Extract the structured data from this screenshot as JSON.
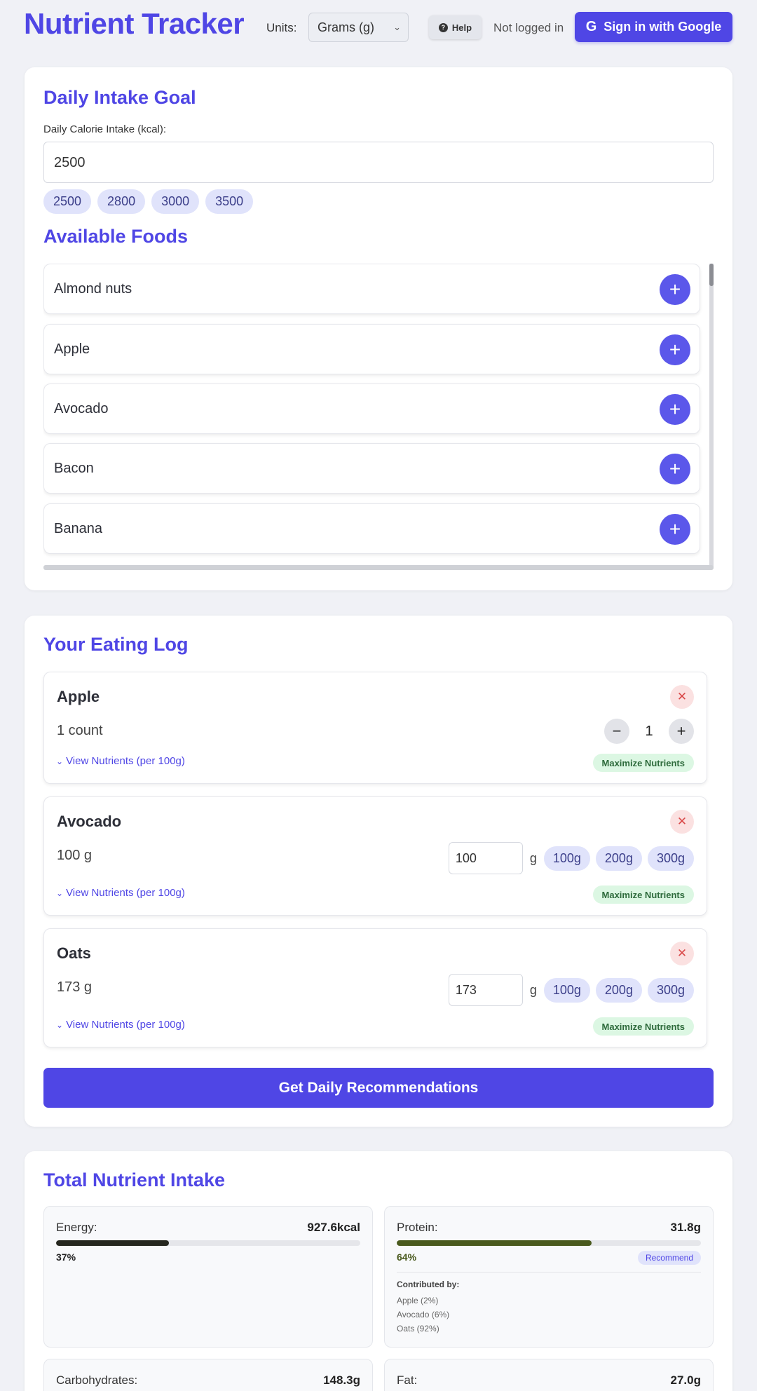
{
  "header": {
    "title": "Nutrient Tracker",
    "units_label": "Units:",
    "units_selected": "Grams (g)",
    "help_label": "Help",
    "login_status": "Not logged in",
    "signin_label": "Sign in with Google",
    "brand_color": "#4f46e5"
  },
  "goal": {
    "title": "Daily Intake Goal",
    "field_label": "Daily Calorie Intake (kcal):",
    "value": "2500",
    "presets": [
      "2500",
      "2800",
      "3000",
      "3500"
    ]
  },
  "foods": {
    "title": "Available Foods",
    "items": [
      "Almond nuts",
      "Apple",
      "Avocado",
      "Bacon",
      "Banana"
    ],
    "add_icon": "plus-icon"
  },
  "log": {
    "title": "Your Eating Log",
    "items": [
      {
        "name": "Apple",
        "qty_text": "1 count",
        "stepper_value": "1",
        "view_label": "View Nutrients (per 100g)",
        "badge": "Maximize Nutrients"
      },
      {
        "name": "Avocado",
        "qty_text": "100 g",
        "amount": "100",
        "unit": "g",
        "chips": [
          "100g",
          "200g",
          "300g"
        ],
        "view_label": "View Nutrients (per 100g)",
        "badge": "Maximize Nutrients"
      },
      {
        "name": "Oats",
        "qty_text": "173 g",
        "amount": "173",
        "unit": "g",
        "chips": [
          "100g",
          "200g",
          "300g"
        ],
        "view_label": "View Nutrients (per 100g)",
        "badge": "Maximize Nutrients"
      }
    ],
    "recommend_button": "Get Daily Recommendations"
  },
  "totals": {
    "title": "Total Nutrient Intake",
    "nutrients": [
      {
        "label": "Energy:",
        "value": "927.6kcal",
        "percent_text": "37%",
        "percent": 37,
        "bar_color": "#26271f"
      },
      {
        "label": "Protein:",
        "value": "31.8g",
        "percent_text": "64%",
        "percent": 64,
        "bar_color": "#4a5a1e",
        "badge": "Recommend",
        "contrib_title": "Contributed by:",
        "contributors": [
          "Apple (2%)",
          "Avocado (6%)",
          "Oats (92%)"
        ]
      },
      {
        "label": "Carbohydrates:",
        "value": "148.3g"
      },
      {
        "label": "Fat:",
        "value": "27.0g"
      }
    ]
  }
}
